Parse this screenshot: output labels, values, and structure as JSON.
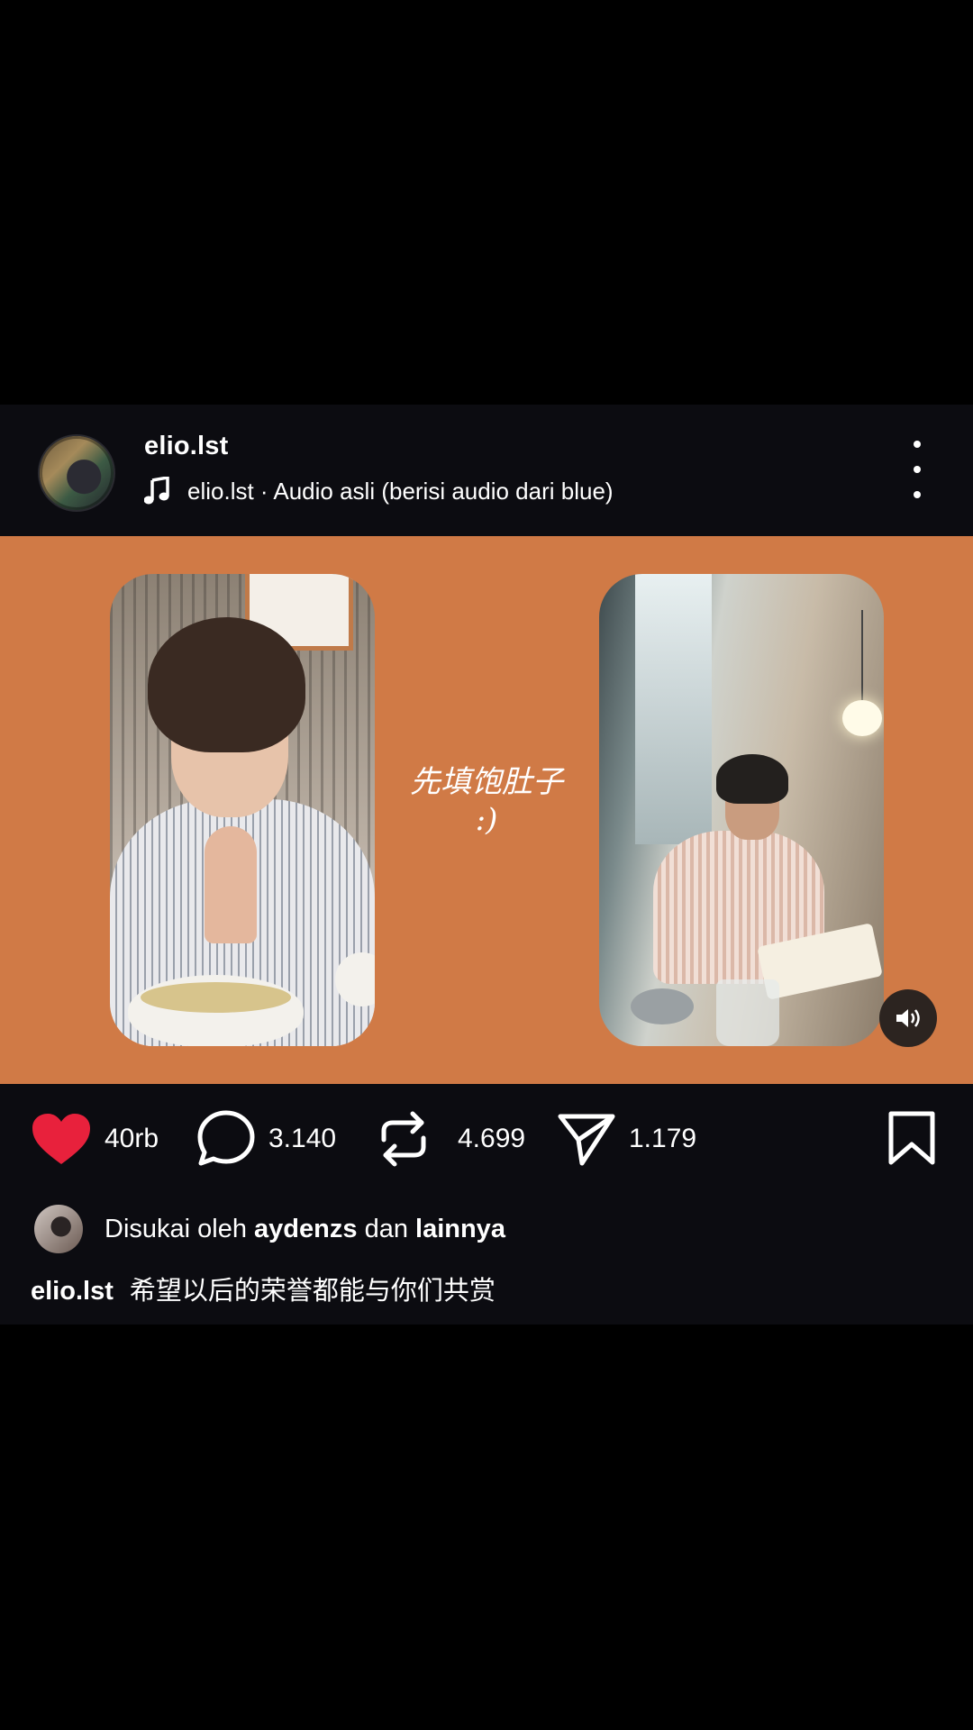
{
  "header": {
    "username": "elio.lst",
    "audio_text": "elio.lst · Audio asli (berisi audio dari blue)"
  },
  "media": {
    "overlay_text_line1": "先填饱肚子",
    "overlay_text_line2": ":)"
  },
  "actions": {
    "like_count": "40rb",
    "comment_count": "3.140",
    "repost_count": "4.699",
    "share_count": "1.179"
  },
  "likes": {
    "prefix": "Disukai oleh",
    "user": "aydenzs",
    "connector": "dan",
    "others": "lainnya"
  },
  "caption": {
    "username": "elio.lst",
    "text": "希望以后的荣誉都能与你们共赏"
  },
  "colors": {
    "media_background": "#d07a46",
    "like_active": "#e8213c",
    "post_background": "#0c0c11"
  },
  "icons": [
    "music-note-icon",
    "more-vertical-icon",
    "volume-icon",
    "heart-icon",
    "comment-icon",
    "repost-icon",
    "share-icon",
    "bookmark-icon"
  ]
}
